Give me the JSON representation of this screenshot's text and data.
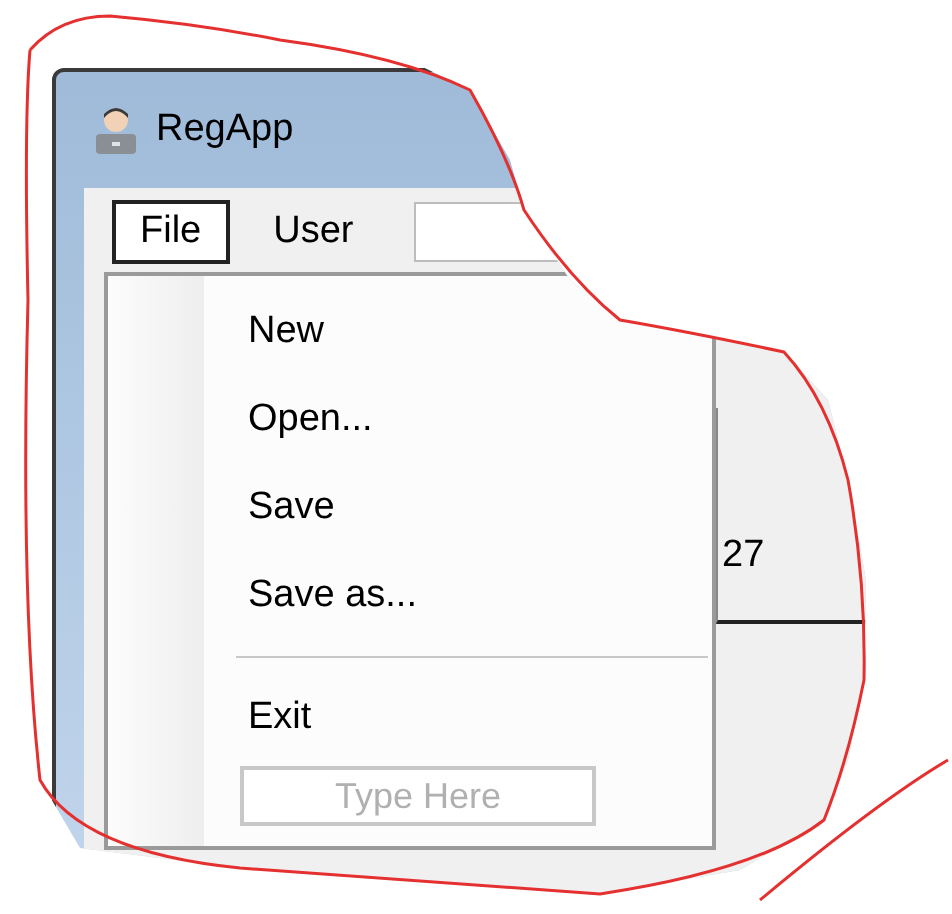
{
  "window": {
    "title": "RegApp"
  },
  "menu_bar": {
    "items": [
      {
        "label": "File",
        "selected": true
      },
      {
        "label": "User",
        "selected": false
      }
    ]
  },
  "file_menu": {
    "items": [
      {
        "kind": "item",
        "label": "New"
      },
      {
        "kind": "item",
        "label": "Open..."
      },
      {
        "kind": "item",
        "label": "Save"
      },
      {
        "kind": "item",
        "label": "Save as..."
      },
      {
        "kind": "separator"
      },
      {
        "kind": "item",
        "label": "Exit"
      }
    ],
    "placeholder": "Type Here"
  },
  "form": {
    "label": "27"
  }
}
